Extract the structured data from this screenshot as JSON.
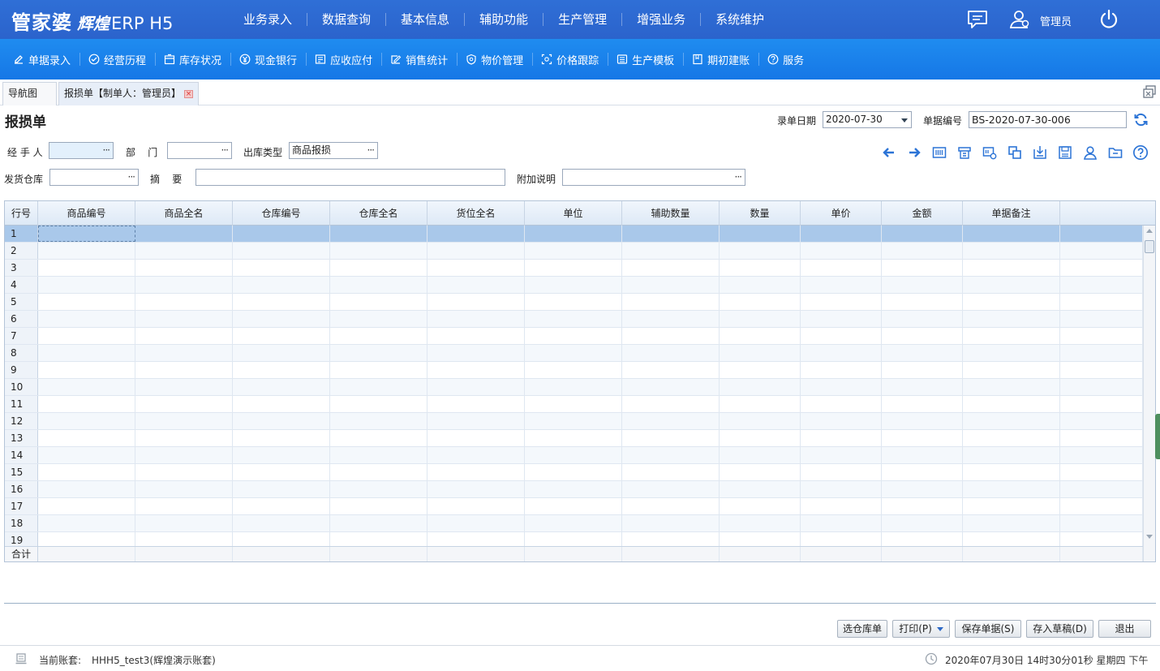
{
  "app": {
    "brand": "管家婆",
    "sub": "辉煌",
    "product": "ERP H5",
    "user": "管理员"
  },
  "colors": {
    "header": "#2b63cc",
    "toolbar": "#1677e6",
    "selected_row": "#a9c8ea",
    "icon_blue": "#2c74d6"
  },
  "main_nav": [
    "业务录入",
    "数据查询",
    "基本信息",
    "辅助功能",
    "生产管理",
    "增强业务",
    "系统维护"
  ],
  "sub_nav": [
    {
      "label": "单据录入",
      "icon": "edit-icon"
    },
    {
      "label": "经营历程",
      "icon": "check-circle-icon"
    },
    {
      "label": "库存状况",
      "icon": "inventory-icon"
    },
    {
      "label": "现金银行",
      "icon": "yen-icon"
    },
    {
      "label": "应收应付",
      "icon": "ledger-icon"
    },
    {
      "label": "销售统计",
      "icon": "chart-edit-icon"
    },
    {
      "label": "物价管理",
      "icon": "shield-icon"
    },
    {
      "label": "价格跟踪",
      "icon": "tracking-icon"
    },
    {
      "label": "生产模板",
      "icon": "template-icon"
    },
    {
      "label": "期初建账",
      "icon": "book-icon"
    },
    {
      "label": "服务",
      "icon": "help-icon"
    }
  ],
  "tabs": {
    "nav": "导航图",
    "active": "报损单【制单人：管理员】"
  },
  "form": {
    "title": "报损单",
    "date_label": "录单日期",
    "date_value": "2020-07-30",
    "number_label": "单据编号",
    "number_value": "BS-2020-07-30-006",
    "handler_label": "经 手 人",
    "handler_value": "",
    "dept_label": "部    门",
    "dept_value": "",
    "outtype_label": "出库类型",
    "outtype_value": "商品报损",
    "warehouse_label": "发货仓库",
    "warehouse_value": "",
    "summary_label": "摘    要",
    "summary_value": "",
    "note_label": "附加说明",
    "note_value": ""
  },
  "grid": {
    "columns": [
      "行号",
      "商品编号",
      "商品全名",
      "仓库编号",
      "仓库全名",
      "货位全名",
      "单位",
      "辅助数量",
      "数量",
      "单价",
      "金额",
      "单据备注"
    ],
    "rows": [
      "1",
      "2",
      "3",
      "4",
      "5",
      "6",
      "7",
      "8",
      "9",
      "10",
      "11",
      "12",
      "13",
      "14",
      "15",
      "16",
      "17",
      "18",
      "19"
    ],
    "footer_label": "合计"
  },
  "buttons": {
    "select_order": "选仓库单",
    "print": "打印(P)",
    "save": "保存单据(S)",
    "draft": "存入草稿(D)",
    "exit": "退出"
  },
  "status": {
    "account_label": "当前账套:",
    "account_value": "HHH5_test3(辉煌演示账套)",
    "datetime": "2020年07月30日 14时30分01秒 星期四 下午"
  }
}
